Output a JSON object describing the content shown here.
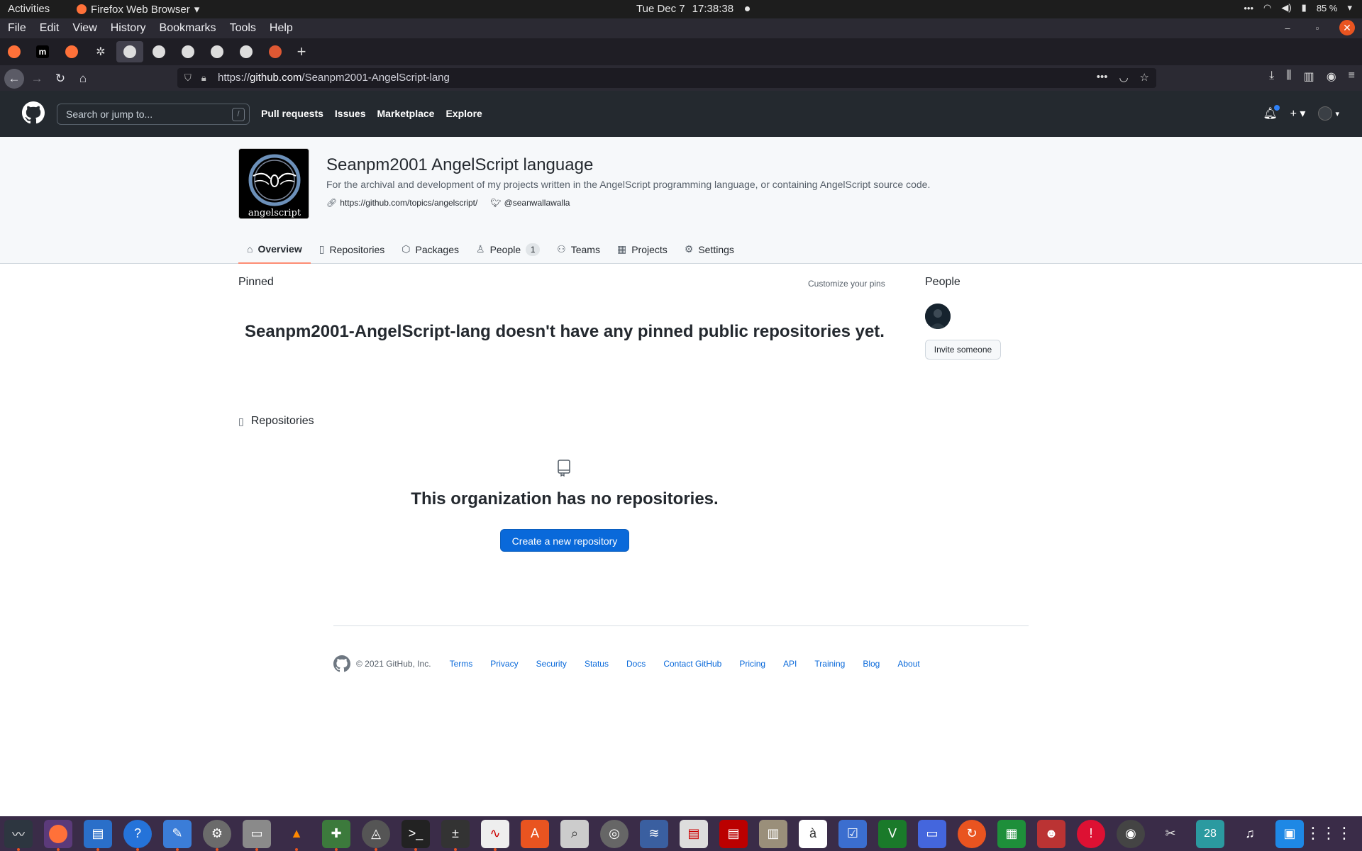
{
  "gnome": {
    "activities": "Activities",
    "app_menu": "Firefox Web Browser",
    "date": "Tue Dec 7",
    "time": "17:38:38",
    "battery": "85 %"
  },
  "firefox": {
    "menus": [
      "File",
      "Edit",
      "View",
      "History",
      "Bookmarks",
      "Tools",
      "Help"
    ],
    "url_prefix": "https://",
    "url_host": "github.com",
    "url_path": "/Seanpm2001-AngelScript-lang"
  },
  "github": {
    "search_placeholder": "Search or jump to...",
    "search_key": "/",
    "nav": [
      "Pull requests",
      "Issues",
      "Marketplace",
      "Explore"
    ]
  },
  "org": {
    "name": "Seanpm2001 AngelScript language",
    "description": "For the archival and development of my projects written in the AngelScript programming language, or containing AngelScript source code.",
    "website": "https://github.com/topics/angelscript/",
    "twitter": "@seanwallawalla",
    "avatar_text": "angelscript",
    "tabs": [
      {
        "label": "Overview",
        "icon": "home-icon"
      },
      {
        "label": "Repositories",
        "icon": "repo-icon"
      },
      {
        "label": "Packages",
        "icon": "package-icon"
      },
      {
        "label": "People",
        "icon": "person-icon",
        "count": "1"
      },
      {
        "label": "Teams",
        "icon": "people-icon"
      },
      {
        "label": "Projects",
        "icon": "project-icon"
      },
      {
        "label": "Settings",
        "icon": "gear-icon"
      }
    ]
  },
  "main": {
    "pinned_label": "Pinned",
    "customize_pins": "Customize your pins",
    "pinned_empty": "Seanpm2001-AngelScript-lang doesn't have any pinned public repositories yet.",
    "repositories_label": "Repositories",
    "no_repos": "This organization has no repositories.",
    "create_repo": "Create a new repository"
  },
  "sidebar": {
    "people_label": "People",
    "invite": "Invite someone"
  },
  "footer": {
    "copyright": "© 2021 GitHub, Inc.",
    "links": [
      "Terms",
      "Privacy",
      "Security",
      "Status",
      "Docs",
      "Contact GitHub",
      "Pricing",
      "API",
      "Training",
      "Blog",
      "About"
    ]
  },
  "dock": {
    "calendar_day": "28"
  },
  "colors": {
    "accent_blue": "#0969da",
    "header_dark": "#24292f",
    "tab_underline": "#fd8c73",
    "dock_bg": "#3a2c48"
  }
}
